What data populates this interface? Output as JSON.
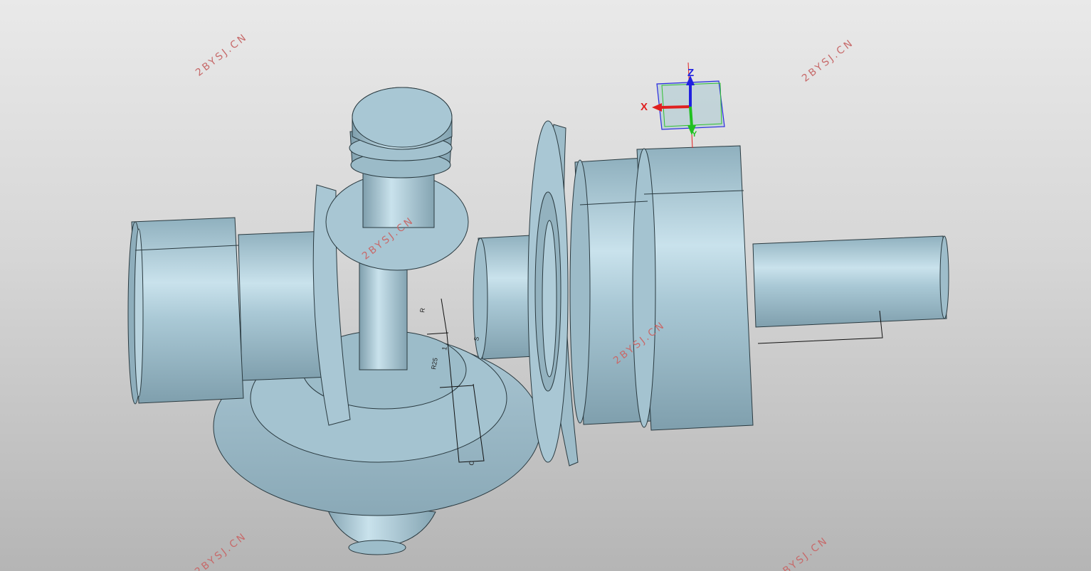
{
  "viewer": {
    "background_top": "#e9e9e9",
    "background_bottom": "#b5b5b5",
    "part_color": "#9fbfcc"
  },
  "watermarks": [
    "2BYSJ.CN",
    "2BYSJ.CN",
    "2BYSJ.CN",
    "2BYSJ.CN",
    "2BYSJ.CN",
    "2BYSJ.CN",
    "2BYSJ.CN"
  ],
  "triad": {
    "x_label": "X",
    "y_label": "Y",
    "z_label": "Z",
    "x_color": "#e02020",
    "y_color": "#20c020",
    "z_color": "#2020e0"
  },
  "dimensions": [
    "R",
    "1",
    "R25",
    "S",
    "C"
  ]
}
